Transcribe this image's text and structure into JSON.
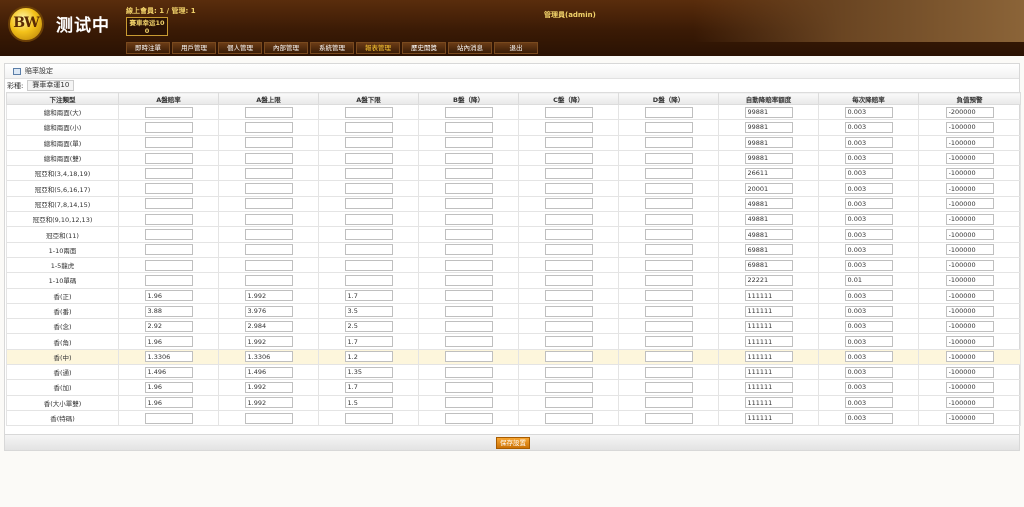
{
  "header": {
    "logo_text": "BW",
    "site_title": "测试中",
    "online_info": "線上會員: 1 / 管理: 1",
    "lottery_badge_line1": "賽車幸运10",
    "lottery_badge_line2": "0",
    "admin_info": "管理員(admin)"
  },
  "nav": [
    {
      "label": "即時注單",
      "active": false
    },
    {
      "label": "用戶管理",
      "active": false
    },
    {
      "label": "個人管理",
      "active": false
    },
    {
      "label": "內部管理",
      "active": false
    },
    {
      "label": "系統管理",
      "active": false
    },
    {
      "label": "報表管理",
      "active": true
    },
    {
      "label": "歷史開獎",
      "active": false
    },
    {
      "label": "站內消息",
      "active": false
    },
    {
      "label": "退出",
      "active": false
    }
  ],
  "panel": {
    "title": "賠率設定",
    "lottery_label": "彩種:",
    "lottery_value": "賽車幸運10"
  },
  "table": {
    "columns": [
      "下注類型",
      "A盤賠率",
      "A盤上限",
      "A盤下限",
      "B盤（降）",
      "C盤（降）",
      "D盤（降）",
      "自動降賠率額度",
      "每次降賠率",
      "負值預警"
    ],
    "rows": [
      {
        "type": "總和兩面(大)",
        "values": [
          "",
          "",
          "",
          "",
          "",
          "",
          "99881",
          "0.003",
          "-200000"
        ]
      },
      {
        "type": "總和兩面(小)",
        "values": [
          "",
          "",
          "",
          "",
          "",
          "",
          "99881",
          "0.003",
          "-100000"
        ]
      },
      {
        "type": "總和兩面(單)",
        "values": [
          "",
          "",
          "",
          "",
          "",
          "",
          "99881",
          "0.003",
          "-100000"
        ]
      },
      {
        "type": "總和兩面(雙)",
        "values": [
          "",
          "",
          "",
          "",
          "",
          "",
          "99881",
          "0.003",
          "-100000"
        ]
      },
      {
        "type": "冠亞和(3,4,18,19)",
        "values": [
          "",
          "",
          "",
          "",
          "",
          "",
          "26611",
          "0.003",
          "-100000"
        ]
      },
      {
        "type": "冠亞和(5,6,16,17)",
        "values": [
          "",
          "",
          "",
          "",
          "",
          "",
          "20001",
          "0.003",
          "-100000"
        ]
      },
      {
        "type": "冠亞和(7,8,14,15)",
        "values": [
          "",
          "",
          "",
          "",
          "",
          "",
          "49881",
          "0.003",
          "-100000"
        ]
      },
      {
        "type": "冠亞和(9,10,12,13)",
        "values": [
          "",
          "",
          "",
          "",
          "",
          "",
          "49881",
          "0.003",
          "-100000"
        ]
      },
      {
        "type": "冠亞和(11)",
        "values": [
          "",
          "",
          "",
          "",
          "",
          "",
          "49881",
          "0.003",
          "-100000"
        ]
      },
      {
        "type": "1-10兩面",
        "values": [
          "",
          "",
          "",
          "",
          "",
          "",
          "69881",
          "0.003",
          "-100000"
        ]
      },
      {
        "type": "1-5龍虎",
        "values": [
          "",
          "",
          "",
          "",
          "",
          "",
          "69881",
          "0.003",
          "-100000"
        ]
      },
      {
        "type": "1-10單碼",
        "values": [
          "",
          "",
          "",
          "",
          "",
          "",
          "22221",
          "0.01",
          "-100000"
        ]
      },
      {
        "type": "香(正)",
        "values": [
          "1.96",
          "1.992",
          "1.7",
          "",
          "",
          "",
          "111111",
          "0.003",
          "-100000"
        ]
      },
      {
        "type": "香(番)",
        "values": [
          "3.88",
          "3.976",
          "3.5",
          "",
          "",
          "",
          "111111",
          "0.003",
          "-100000"
        ]
      },
      {
        "type": "香(念)",
        "values": [
          "2.92",
          "2.984",
          "2.5",
          "",
          "",
          "",
          "111111",
          "0.003",
          "-100000"
        ]
      },
      {
        "type": "香(角)",
        "values": [
          "1.96",
          "1.992",
          "1.7",
          "",
          "",
          "",
          "111111",
          "0.003",
          "-100000"
        ]
      },
      {
        "type": "香(中)",
        "values": [
          "1.3306",
          "1.3306",
          "1.2",
          "",
          "",
          "",
          "111111",
          "0.003",
          "-100000"
        ],
        "highlight": true
      },
      {
        "type": "香(通)",
        "values": [
          "1.496",
          "1.496",
          "1.35",
          "",
          "",
          "",
          "111111",
          "0.003",
          "-100000"
        ]
      },
      {
        "type": "香(加)",
        "values": [
          "1.96",
          "1.992",
          "1.7",
          "",
          "",
          "",
          "111111",
          "0.003",
          "-100000"
        ]
      },
      {
        "type": "香(大小單雙)",
        "values": [
          "1.96",
          "1.992",
          "1.5",
          "",
          "",
          "",
          "111111",
          "0.003",
          "-100000"
        ]
      },
      {
        "type": "香(特碼)",
        "values": [
          "",
          "",
          "",
          "",
          "",
          "",
          "111111",
          "0.003",
          "-100000"
        ]
      }
    ]
  },
  "footer": {
    "save_label": "保存設置"
  }
}
